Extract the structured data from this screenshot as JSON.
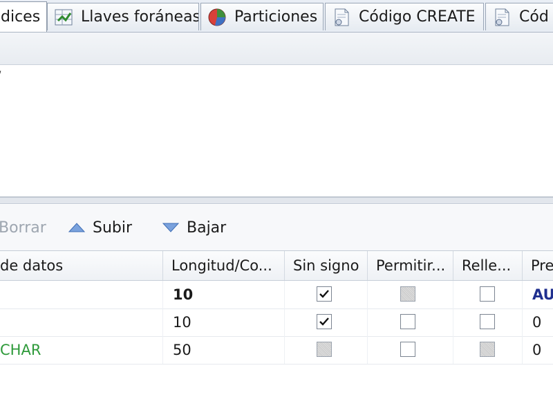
{
  "tabs": [
    {
      "label": "dices",
      "icon": "index-icon",
      "active": true
    },
    {
      "label": "Llaves foráneas",
      "icon": "foreign-key-icon",
      "active": false
    },
    {
      "label": "Particiones",
      "icon": "pie-chart-icon",
      "active": false
    },
    {
      "label": "Código CREATE",
      "icon": "sql-document-icon",
      "active": false
    },
    {
      "label": "Cód",
      "icon": "sql-document-icon",
      "active": false
    }
  ],
  "upper": {
    "text": "/"
  },
  "toolbar": {
    "delete_label": "Borrar",
    "up_label": "Subir",
    "down_label": "Bajar"
  },
  "grid": {
    "headers": [
      "de datos",
      "Longitud/Co...",
      "Sin signo",
      "Permitir...",
      "Relle...",
      "Pre"
    ],
    "rows": [
      {
        "type": "",
        "length": "10",
        "unsigned": "checked",
        "allow_null": "disabled",
        "zerofill": "unchecked",
        "default": "AU"
      },
      {
        "type": "",
        "length": "10",
        "unsigned": "checked",
        "allow_null": "unchecked",
        "zerofill": "unchecked",
        "default": "0"
      },
      {
        "type": "CHAR",
        "length": "50",
        "unsigned": "disabled",
        "allow_null": "unchecked",
        "zerofill": "disabled",
        "default": "0"
      }
    ]
  },
  "colors": {
    "accent_blue": "#1f2f8f",
    "type_green": "#2e9a3a",
    "disabled_text": "#9ea6b0"
  }
}
